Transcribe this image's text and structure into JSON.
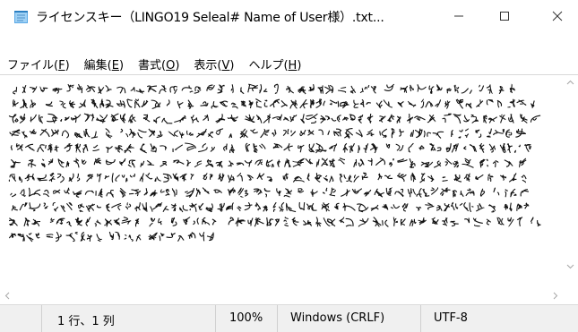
{
  "window": {
    "title": "ライセンスキー（LINGO19 Seleal# Name of User様）.txt...",
    "minimize_glyph": "—",
    "maximize_glyph": "☐",
    "close_glyph": "✕"
  },
  "menu": {
    "items": [
      {
        "label": "ファイル(",
        "accel": "F",
        "end": ")"
      },
      {
        "label": "編集(",
        "accel": "E",
        "end": ")"
      },
      {
        "label": "書式(",
        "accel": "O",
        "end": ")"
      },
      {
        "label": "表示(",
        "accel": "V",
        "end": ")"
      },
      {
        "label": "ヘルプ(",
        "accel": "H",
        "end": ")"
      }
    ]
  },
  "editor": {
    "content_description": "garbled-text",
    "lines": 12
  },
  "statusbar": {
    "position": "1 行、1 列",
    "zoom": "100%",
    "line_ending": "Windows (CRLF)",
    "encoding": "UTF-8"
  },
  "icons": {
    "app": "notepad-icon",
    "scroll_up": "scroll-up-arrow-icon",
    "scroll_down": "scroll-down-arrow-icon",
    "scroll_left": "scroll-left-arrow-icon",
    "scroll_right": "scroll-right-arrow-icon"
  }
}
